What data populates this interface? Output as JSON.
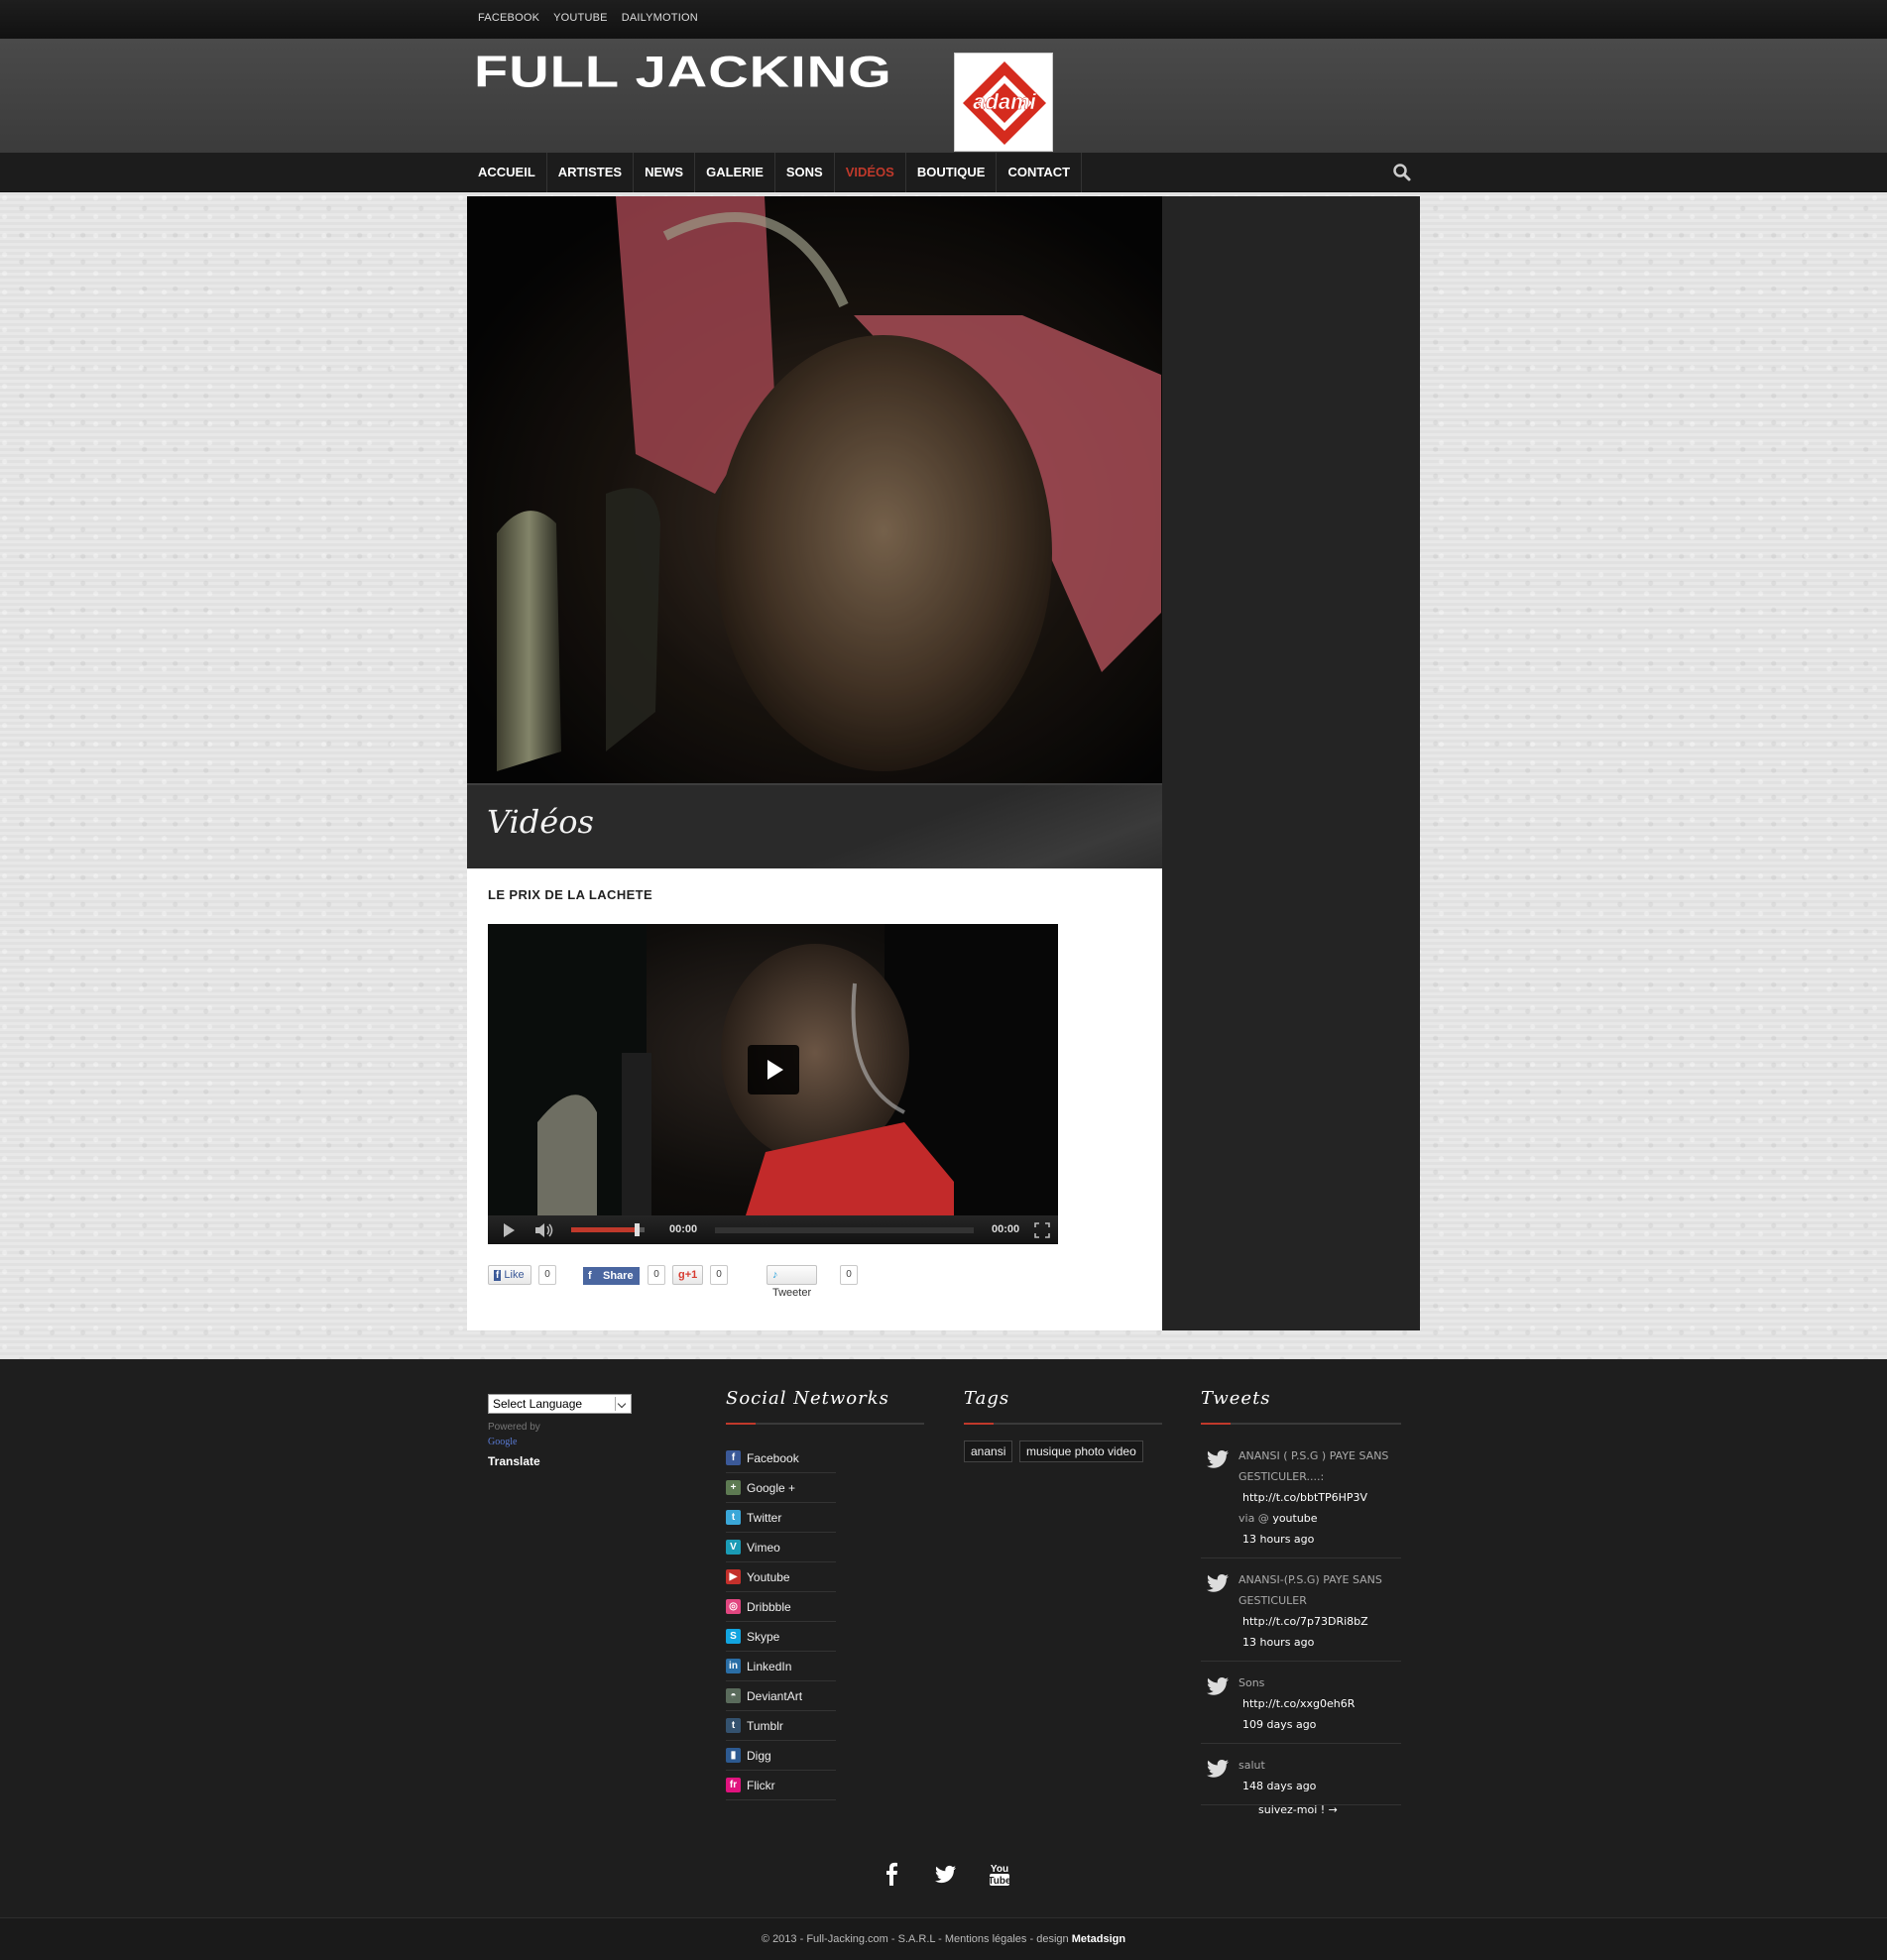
{
  "topbar": {
    "links": [
      "FACEBOOK",
      "YOUTUBE",
      "DAILYMOTION"
    ]
  },
  "header": {
    "logo_text": "FULL JACKING",
    "badge_text": "adami"
  },
  "nav": {
    "items": [
      "ACCUEIL",
      "ARTISTES",
      "NEWS",
      "GALERIE",
      "SONS",
      "VIDÉOS",
      "BOUTIQUE",
      "CONTACT"
    ],
    "active_index": 5,
    "search_icon": "search-icon"
  },
  "page": {
    "title": "Vidéos",
    "post_title": "LE PRIX DE LA LACHETE"
  },
  "player": {
    "current_time": "00:00",
    "duration": "00:00",
    "volume": 0.9
  },
  "share": {
    "like_label": "Like",
    "like_count": "0",
    "share_label": "Share",
    "share_count": "0",
    "gplus_label": "+1",
    "gplus_count": "0",
    "tweet_label": "Tweeter",
    "tweet_count": "0"
  },
  "footer": {
    "language": {
      "select_value": "Select Language",
      "powered_by": "Powered by",
      "google": "Google",
      "translate": "Translate"
    },
    "social": {
      "heading": "Social Networks",
      "items": [
        {
          "label": "Facebook",
          "glyph": "f",
          "color": "#3b5998"
        },
        {
          "label": "Google +",
          "glyph": "+",
          "color": "#5d7a52"
        },
        {
          "label": "Twitter",
          "glyph": "t",
          "color": "#3aa7d8"
        },
        {
          "label": "Vimeo",
          "glyph": "V",
          "color": "#1a9bb5"
        },
        {
          "label": "Youtube",
          "glyph": "▶",
          "color": "#c4302b"
        },
        {
          "label": "Dribbble",
          "glyph": "◎",
          "color": "#e14680"
        },
        {
          "label": "Skype",
          "glyph": "S",
          "color": "#12a5e0"
        },
        {
          "label": "LinkedIn",
          "glyph": "in",
          "color": "#2a6ea6"
        },
        {
          "label": "DeviantArt",
          "glyph": "◓",
          "color": "#5a6b5c"
        },
        {
          "label": "Tumblr",
          "glyph": "t",
          "color": "#34526f"
        },
        {
          "label": "Digg",
          "glyph": "▮",
          "color": "#2d5a91"
        },
        {
          "label": "Flickr",
          "glyph": "fr",
          "color": "#e0137e"
        }
      ]
    },
    "tags": {
      "heading": "Tags",
      "items": [
        "anansi",
        "musique photo video"
      ]
    },
    "tweets": {
      "heading": "Tweets",
      "items": [
        {
          "text": "ANANSI ( P.S.G ) PAYE SANS GESTICULER....:",
          "link": "http://t.co/bbtTP6HP3V",
          "via": "via @",
          "via_user": "youtube",
          "time": "13 hours ago"
        },
        {
          "text": "ANANSI-(P.S.G) PAYE SANS GESTICULER",
          "link": "http://t.co/7p73DRi8bZ",
          "time": "13 hours ago"
        },
        {
          "text": "Sons",
          "link": "http://t.co/xxg0eh6R",
          "time": "109 days ago"
        },
        {
          "text": "salut",
          "time": "148 days ago"
        }
      ],
      "follow": "suivez-moi ! →"
    },
    "bottom_icons": [
      "facebook-icon",
      "twitter-icon",
      "youtube-icon"
    ],
    "copyright": "© 2013 - Full-Jacking.com - S.A.R.L - Mentions légales - design",
    "designer": "Metadsign"
  }
}
